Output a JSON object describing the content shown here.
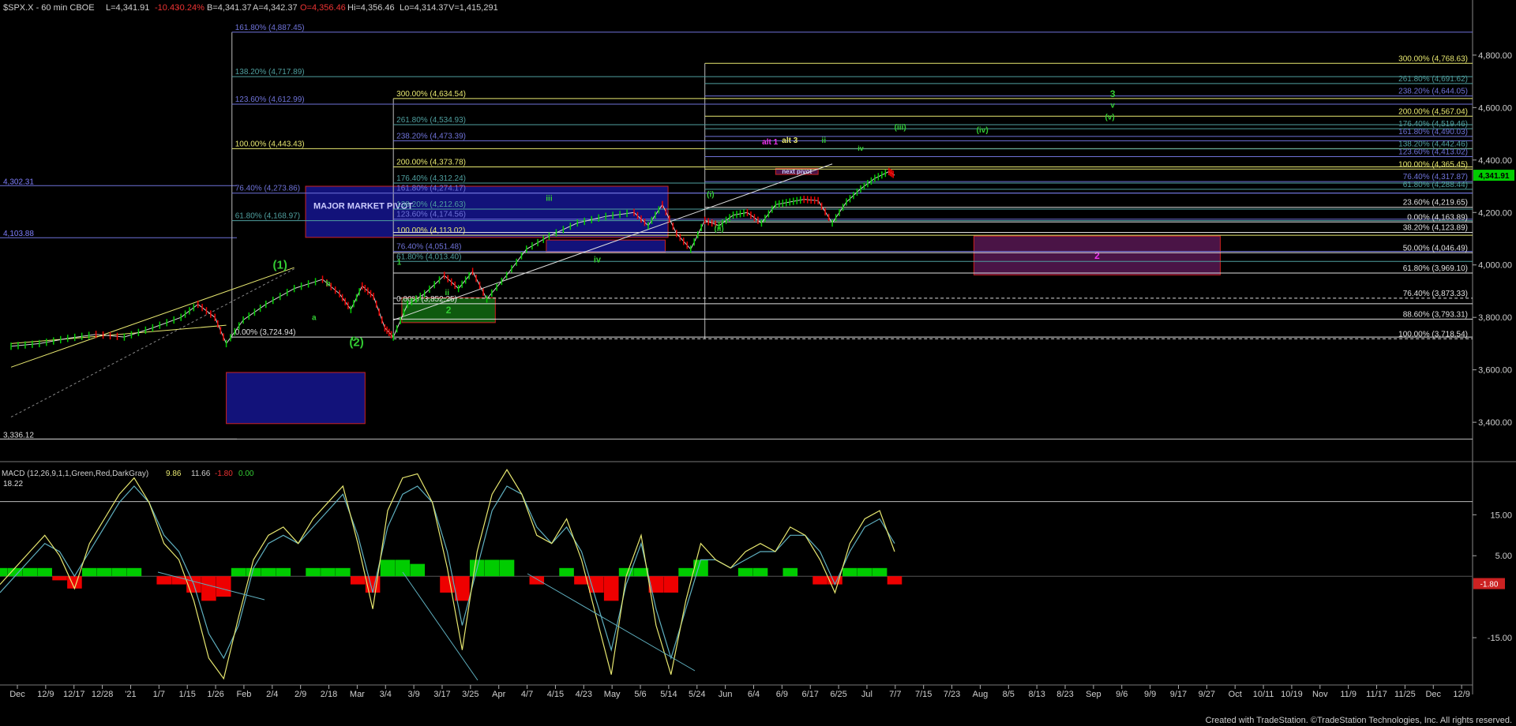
{
  "header": {
    "symbol": "$SPX.X - 60 min  CBOE",
    "last": "L=4,341.91",
    "change": "-10.43",
    "change_pct": "-0.24%",
    "bid": "B=4,341.37",
    "ask": "A=4,342.37",
    "open": "O=4,356.46",
    "high": "Hi=4,356.46",
    "low": "Lo=4,314.37",
    "volume": "V=1,415,291"
  },
  "footer": {
    "credit": "Created with TradeStation. ©TradeStation Technologies, Inc. All rights reserved."
  },
  "colors": {
    "background": "#000000",
    "bull": "#00cc00",
    "bear": "#ee0000",
    "yellow_fib": "#e8e870",
    "blue_fib": "#6f73d9",
    "teal_fib": "#4f9f9f",
    "white_fib": "#e0e0e0",
    "green_label": "#33cc33",
    "purple_box": "#5a1a5a",
    "current_price_tag": "#00cc00"
  },
  "chart_data": [
    {
      "type": "line",
      "title": "$SPX.X - 60 min",
      "ylim": [
        3280,
        4950
      ],
      "y_ticks": [
        {
          "value": 3400,
          "label": "3,400.00"
        },
        {
          "value": 3600,
          "label": "3,600.00"
        },
        {
          "value": 3800,
          "label": "3,800.00"
        },
        {
          "value": 4000,
          "label": "4,000.00"
        },
        {
          "value": 4200,
          "label": "4,200.00"
        },
        {
          "value": 4400,
          "label": "4,400.00"
        },
        {
          "value": 4600,
          "label": "4,600.00"
        },
        {
          "value": 4800,
          "label": "4,800.00"
        }
      ],
      "x_ticks": [
        "Dec",
        "12/9",
        "12/17",
        "12/28",
        "'21",
        "1/7",
        "1/15",
        "1/26",
        "Feb",
        "2/4",
        "2/9",
        "2/18",
        "Mar",
        "3/4",
        "3/9",
        "3/17",
        "3/25",
        "Apr",
        "4/7",
        "4/15",
        "4/23",
        "May",
        "5/6",
        "5/14",
        "5/24",
        "Jun",
        "6/4",
        "6/9",
        "6/17",
        "6/25",
        "Jul",
        "7/7",
        "7/15",
        "7/23",
        "Aug",
        "8/5",
        "8/13",
        "8/23",
        "Sep",
        "9/6",
        "9/9",
        "9/17",
        "9/27",
        "Oct",
        "10/11",
        "10/19",
        "Nov",
        "11/9",
        "11/17",
        "11/25",
        "Dec",
        "12/9"
      ],
      "current_price": {
        "value": 4341.91,
        "label": "4,341.91"
      },
      "price_path": [
        {
          "x": 0.0,
          "y": 3690
        },
        {
          "x": 1.0,
          "y": 3700
        },
        {
          "x": 2.0,
          "y": 3720
        },
        {
          "x": 3.0,
          "y": 3735
        },
        {
          "x": 4.0,
          "y": 3725
        },
        {
          "x": 5.0,
          "y": 3760
        },
        {
          "x": 6.0,
          "y": 3800
        },
        {
          "x": 6.6,
          "y": 3850
        },
        {
          "x": 7.2,
          "y": 3800
        },
        {
          "x": 7.6,
          "y": 3700
        },
        {
          "x": 8.2,
          "y": 3790
        },
        {
          "x": 9.0,
          "y": 3850
        },
        {
          "x": 10.0,
          "y": 3910
        },
        {
          "x": 11.0,
          "y": 3945
        },
        {
          "x": 11.6,
          "y": 3890
        },
        {
          "x": 12.0,
          "y": 3830
        },
        {
          "x": 12.4,
          "y": 3920
        },
        {
          "x": 12.8,
          "y": 3880
        },
        {
          "x": 13.2,
          "y": 3760
        },
        {
          "x": 13.5,
          "y": 3725
        },
        {
          "x": 14.0,
          "y": 3850
        },
        {
          "x": 14.6,
          "y": 3890
        },
        {
          "x": 15.3,
          "y": 3960
        },
        {
          "x": 15.8,
          "y": 3910
        },
        {
          "x": 16.3,
          "y": 3975
        },
        {
          "x": 16.8,
          "y": 3870
        },
        {
          "x": 17.5,
          "y": 3960
        },
        {
          "x": 18.2,
          "y": 4060
        },
        {
          "x": 19.0,
          "y": 4110
        },
        {
          "x": 20.0,
          "y": 4160
        },
        {
          "x": 21.0,
          "y": 4185
        },
        {
          "x": 22.0,
          "y": 4200
        },
        {
          "x": 22.5,
          "y": 4150
        },
        {
          "x": 23.0,
          "y": 4230
        },
        {
          "x": 23.5,
          "y": 4120
        },
        {
          "x": 24.0,
          "y": 4060
        },
        {
          "x": 24.5,
          "y": 4170
        },
        {
          "x": 25.0,
          "y": 4150
        },
        {
          "x": 25.5,
          "y": 4190
        },
        {
          "x": 26.0,
          "y": 4200
        },
        {
          "x": 26.5,
          "y": 4160
        },
        {
          "x": 27.0,
          "y": 4230
        },
        {
          "x": 27.5,
          "y": 4240
        },
        {
          "x": 28.0,
          "y": 4250
        },
        {
          "x": 28.5,
          "y": 4245
        },
        {
          "x": 29.0,
          "y": 4160
        },
        {
          "x": 29.5,
          "y": 4240
        },
        {
          "x": 30.0,
          "y": 4290
        },
        {
          "x": 30.5,
          "y": 4330
        },
        {
          "x": 31.0,
          "y": 4356
        },
        {
          "x": 31.2,
          "y": 4341.91
        }
      ],
      "candles_shown": "approx"
    },
    {
      "type": "line",
      "title": "MACD (12,26,9,1,1,Green,Red,DarkGray)",
      "values_label": [
        "9.86",
        "11.66",
        "-1.80",
        "0.00"
      ],
      "ylim": [
        -25,
        27
      ],
      "y_ticks": [
        {
          "value": 15,
          "label": "15.00"
        },
        {
          "value": 5,
          "label": "5.00"
        },
        {
          "value": -15,
          "label": "-15.00"
        }
      ],
      "left_value": "18.22",
      "current_tag": "-1.80",
      "macd": [
        -2,
        2,
        6,
        10,
        5,
        -3,
        8,
        14,
        20,
        24,
        18,
        8,
        4,
        -6,
        -20,
        -25,
        -10,
        4,
        10,
        12,
        8,
        14,
        18,
        22,
        8,
        -8,
        16,
        24,
        25,
        18,
        2,
        -18,
        6,
        20,
        26,
        20,
        10,
        8,
        14,
        4,
        -10,
        -24,
        0,
        10,
        -12,
        -24,
        -6,
        8,
        4,
        2,
        6,
        8,
        6,
        12,
        10,
        4,
        -4,
        8,
        14,
        16,
        6
      ],
      "signal": [
        -4,
        0,
        4,
        8,
        6,
        0,
        6,
        12,
        18,
        22,
        18,
        10,
        6,
        -2,
        -14,
        -20,
        -12,
        2,
        8,
        10,
        8,
        12,
        16,
        20,
        10,
        -4,
        12,
        20,
        22,
        18,
        6,
        -12,
        2,
        16,
        22,
        20,
        12,
        8,
        12,
        6,
        -6,
        -18,
        -2,
        8,
        -8,
        -20,
        -8,
        4,
        4,
        2,
        4,
        6,
        6,
        10,
        10,
        6,
        -2,
        6,
        12,
        14,
        8
      ],
      "hist": [
        2,
        2,
        2,
        2,
        -1,
        -3,
        2,
        2,
        2,
        2,
        0,
        -2,
        -2,
        -4,
        -6,
        -5,
        2,
        2,
        2,
        2,
        0,
        2,
        2,
        2,
        -2,
        -4,
        4,
        4,
        3,
        0,
        -4,
        -6,
        4,
        4,
        4,
        0,
        -2,
        0,
        2,
        -2,
        -4,
        -6,
        2,
        2,
        -4,
        -4,
        2,
        4,
        0,
        0,
        2,
        2,
        0,
        2,
        0,
        -2,
        -2,
        2,
        2,
        2,
        -2
      ]
    }
  ],
  "fib_lines": [
    {
      "label": "161.80% (4,887.45)",
      "value": 4887.45,
      "color": "blue",
      "x1": 7.8,
      "x2": 48
    },
    {
      "label": "138.20% (4,717.89)",
      "value": 4717.89,
      "color": "teal",
      "x1": 7.8,
      "x2": 48
    },
    {
      "label": "123.60% (4,612.99)",
      "value": 4612.99,
      "color": "blue",
      "x1": 7.8,
      "x2": 48
    },
    {
      "label": "100.00% (4,443.43)",
      "value": 4443.43,
      "color": "yellow",
      "x1": 7.8,
      "x2": 48
    },
    {
      "label": "76.40% (4,273.86)",
      "value": 4273.86,
      "color": "blue",
      "x1": 7.8,
      "x2": 48
    },
    {
      "label": "61.80% (4,168.97)",
      "value": 4168.97,
      "color": "teal",
      "x1": 7.8,
      "x2": 48
    },
    {
      "label": "0.00% (3,724.94)",
      "value": 3724.94,
      "color": "white",
      "x1": 7.8,
      "x2": 13.5
    },
    {
      "label": "300.00% (4,634.54)",
      "value": 4634.54,
      "color": "yellow",
      "x1": 13.5,
      "x2": 48
    },
    {
      "label": "261.80% (4,534.93)",
      "value": 4534.93,
      "color": "teal",
      "x1": 13.5,
      "x2": 48
    },
    {
      "label": "238.20% (4,473.39)",
      "value": 4473.39,
      "color": "blue",
      "x1": 13.5,
      "x2": 48
    },
    {
      "label": "200.00% (4,373.78)",
      "value": 4373.78,
      "color": "yellow",
      "x1": 13.5,
      "x2": 48
    },
    {
      "label": "176.40% (4,312.24)",
      "value": 4312.24,
      "color": "teal",
      "x1": 13.5,
      "x2": 48
    },
    {
      "label": "161.80% (4,274.17)",
      "value": 4274.17,
      "color": "blue",
      "x1": 13.5,
      "x2": 48
    },
    {
      "label": "138.20% (4,212.63)",
      "value": 4212.63,
      "color": "teal",
      "x1": 13.5,
      "x2": 48
    },
    {
      "label": "123.60% (4,174.56)",
      "value": 4174.56,
      "color": "blue",
      "x1": 13.5,
      "x2": 48
    },
    {
      "label": "100.00% (4,113.02)",
      "value": 4113.02,
      "color": "yellow",
      "x1": 13.5,
      "x2": 48
    },
    {
      "label": "76.40% (4,051.48)",
      "value": 4051.48,
      "color": "blue",
      "x1": 13.5,
      "x2": 48
    },
    {
      "label": "61.80% (4,013.40)",
      "value": 4013.4,
      "color": "teal",
      "x1": 13.5,
      "x2": 48
    },
    {
      "label": "0.00% (3,852.25)",
      "value": 3852.25,
      "color": "white",
      "x1": 13.5,
      "x2": 48
    },
    {
      "label": "300.00% (4,768.63)",
      "value": 4768.63,
      "color": "yellow",
      "x1": 24.5,
      "x2": 48,
      "right": true
    },
    {
      "label": "261.80% (4,691.62)",
      "value": 4691.62,
      "color": "teal",
      "x1": 24.5,
      "x2": 48,
      "right": true
    },
    {
      "label": "238.20% (4,644.05)",
      "value": 4644.05,
      "color": "blue",
      "x1": 24.5,
      "x2": 48,
      "right": true
    },
    {
      "label": "200.00% (4,567.04)",
      "value": 4567.04,
      "color": "yellow",
      "x1": 24.5,
      "x2": 48,
      "right": true
    },
    {
      "label": "176.40% (4,519.46)",
      "value": 4519.46,
      "color": "teal",
      "x1": 24.5,
      "x2": 48,
      "right": true
    },
    {
      "label": "161.80% (4,490.03)",
      "value": 4490.03,
      "color": "blue",
      "x1": 24.5,
      "x2": 48,
      "right": true
    },
    {
      "label": "138.20% (4,442.46)",
      "value": 4442.46,
      "color": "teal",
      "x1": 24.5,
      "x2": 48,
      "right": true
    },
    {
      "label": "123.60% (4,413.02)",
      "value": 4413.02,
      "color": "blue",
      "x1": 24.5,
      "x2": 48,
      "right": true
    },
    {
      "label": "100.00% (4,365.45)",
      "value": 4365.45,
      "color": "yellow",
      "x1": 24.5,
      "x2": 48,
      "right": true
    },
    {
      "label": "76.40% (4,317.87)",
      "value": 4317.87,
      "color": "blue",
      "x1": 24.5,
      "x2": 48,
      "right": true
    },
    {
      "label": "61.80% (4,288.44)",
      "value": 4288.44,
      "color": "teal",
      "x1": 24.5,
      "x2": 48,
      "right": true
    },
    {
      "label": "23.60% (4,219.65)",
      "value": 4219.65,
      "color": "white",
      "x1": 24.5,
      "x2": 48,
      "right": true
    },
    {
      "label": "0.00% (4,163.89)",
      "value": 4163.89,
      "color": "white",
      "x1": 24.5,
      "x2": 48,
      "right": true
    },
    {
      "label": "38.20% (4,123.89)",
      "value": 4123.89,
      "color": "white",
      "x1": 13.5,
      "x2": 48,
      "right": true
    },
    {
      "label": "50.00% (4,046.49)",
      "value": 4046.49,
      "color": "white",
      "x1": 13.5,
      "x2": 48,
      "right": true
    },
    {
      "label": "61.80% (3,969.10)",
      "value": 3969.1,
      "color": "white",
      "x1": 13.5,
      "x2": 48,
      "right": true
    },
    {
      "label": "76.40% (3,873.33)",
      "value": 3873.33,
      "color": "white",
      "x1": 13.5,
      "x2": 48,
      "right": true,
      "dashed": true
    },
    {
      "label": "88.60% (3,793.31)",
      "value": 3793.31,
      "color": "white",
      "x1": 13.5,
      "x2": 48,
      "right": true
    },
    {
      "label": "100.00% (3,718.54)",
      "value": 3718.54,
      "color": "white",
      "x1": 13.5,
      "x2": 48,
      "right": true,
      "dashed": true
    }
  ],
  "left_levels": [
    {
      "label": "4,302.31",
      "value": 4302.31
    },
    {
      "label": "4,103.88",
      "value": 4103.88
    },
    {
      "label": "3,336.12",
      "value": 3336.12
    }
  ],
  "boxes": [
    {
      "label": "MAJOR MARKET PIVOT",
      "x1": 10.4,
      "x2": 23.2,
      "y1": 4300,
      "y2": 4105,
      "fill": "#12127a",
      "stroke": "#cc2222"
    },
    {
      "label": "",
      "x1": 7.6,
      "x2": 12.5,
      "y1": 3590,
      "y2": 3395,
      "fill": "#12127a",
      "stroke": "#cc2222"
    },
    {
      "label": "",
      "x1": 18.9,
      "x2": 23.1,
      "y1": 4095,
      "y2": 4050,
      "fill": "#12127a",
      "stroke": "#cc2222"
    },
    {
      "label": "2",
      "x1": 13.8,
      "x2": 17.1,
      "y1": 3875,
      "y2": 3780,
      "fill": "#0f5a0f",
      "stroke": "#cc2222"
    },
    {
      "label": "2",
      "x1": 34.0,
      "x2": 42.7,
      "y1": 4110,
      "y2": 3962,
      "fill": "#4a1446",
      "stroke": "#cc2222"
    },
    {
      "label": "next pivot",
      "x1": 27.0,
      "x2": 28.5,
      "y1": 4368,
      "y2": 4345,
      "fill": "#4a1446",
      "stroke": "#cc2222"
    }
  ],
  "wave_labels": [
    {
      "text": "(1)",
      "x": 9.5,
      "y": 3985,
      "color": "#33cc33",
      "size": 15
    },
    {
      "text": "(2)",
      "x": 12.2,
      "y": 3690,
      "color": "#33cc33",
      "size": 15
    },
    {
      "text": "a",
      "x": 10.7,
      "y": 3790,
      "color": "#33cc33",
      "size": 10
    },
    {
      "text": "b",
      "x": 11.2,
      "y": 3920,
      "color": "#33cc33",
      "size": 10
    },
    {
      "text": "c",
      "x": 12.1,
      "y": 3710,
      "color": "#33cc33",
      "size": 10
    },
    {
      "text": "1",
      "x": 13.7,
      "y": 4000,
      "color": "#33cc33",
      "size": 10
    },
    {
      "text": "ii",
      "x": 15.4,
      "y": 3885,
      "color": "#33cc33",
      "size": 10
    },
    {
      "text": "iii",
      "x": 19.0,
      "y": 4245,
      "color": "#33cc33",
      "size": 10
    },
    {
      "text": "iv",
      "x": 20.7,
      "y": 4010,
      "color": "#33cc33",
      "size": 11
    },
    {
      "text": "(i)",
      "x": 24.7,
      "y": 4260,
      "color": "#33cc33",
      "size": 10
    },
    {
      "text": "(ii)",
      "x": 25.0,
      "y": 4128,
      "color": "#33cc33",
      "size": 10
    },
    {
      "text": "(iii)",
      "x": 31.4,
      "y": 4515,
      "color": "#33cc33",
      "size": 10
    },
    {
      "text": "(iv)",
      "x": 34.3,
      "y": 4505,
      "color": "#33cc33",
      "size": 10
    },
    {
      "text": "(v)",
      "x": 38.8,
      "y": 4555,
      "color": "#33cc33",
      "size": 10
    },
    {
      "text": "v",
      "x": 38.9,
      "y": 4600,
      "color": "#33cc33",
      "size": 10
    },
    {
      "text": "3",
      "x": 38.9,
      "y": 4640,
      "color": "#33cc33",
      "size": 12
    },
    {
      "text": "ii",
      "x": 28.7,
      "y": 4465,
      "color": "#33cc33",
      "size": 10
    },
    {
      "text": "iv",
      "x": 30.0,
      "y": 4435,
      "color": "#33cc33",
      "size": 9
    },
    {
      "text": "alt 1",
      "x": 26.8,
      "y": 4460,
      "color": "#ee33ee",
      "size": 10
    },
    {
      "text": "alt 3",
      "x": 27.5,
      "y": 4465,
      "color": "#e8e870",
      "size": 10
    }
  ]
}
